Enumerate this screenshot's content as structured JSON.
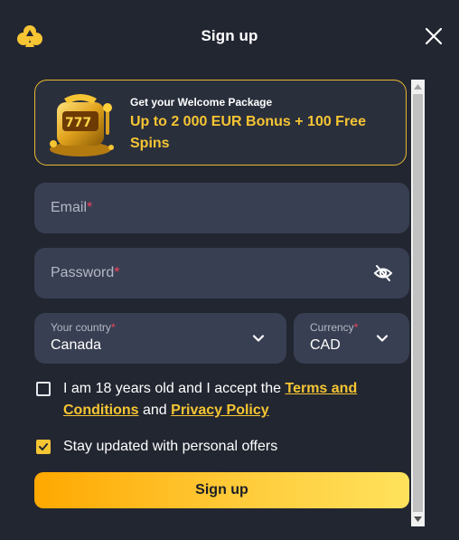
{
  "header": {
    "title": "Sign up",
    "logo_icon": "spade-clover-logo-icon",
    "close_icon": "close-icon"
  },
  "banner": {
    "small_text": "Get your Welcome Package",
    "big_text": "Up to 2 000 EUR Bonus + 100 Free Spins",
    "image": "slot-machine-icon"
  },
  "form": {
    "email": {
      "placeholder": "Email",
      "required_mark": "*"
    },
    "password": {
      "placeholder": "Password",
      "required_mark": "*",
      "icon": "eye-off-icon"
    },
    "country": {
      "label": "Your country",
      "required_mark": "*",
      "value": "Canada"
    },
    "currency": {
      "label": "Currency",
      "required_mark": "*",
      "value": "CAD"
    },
    "terms": {
      "checked": false,
      "text_before": "I am 18 years old and I accept the ",
      "terms_link": "Terms and Conditions",
      "text_middle": " and ",
      "privacy_link": "Privacy Policy"
    },
    "offers": {
      "checked": true,
      "text": "Stay updated with personal offers"
    },
    "submit_label": "Sign up"
  },
  "colors": {
    "background": "#222631",
    "field": "#393f52",
    "accent": "#f6c533",
    "required": "#f2415b"
  }
}
